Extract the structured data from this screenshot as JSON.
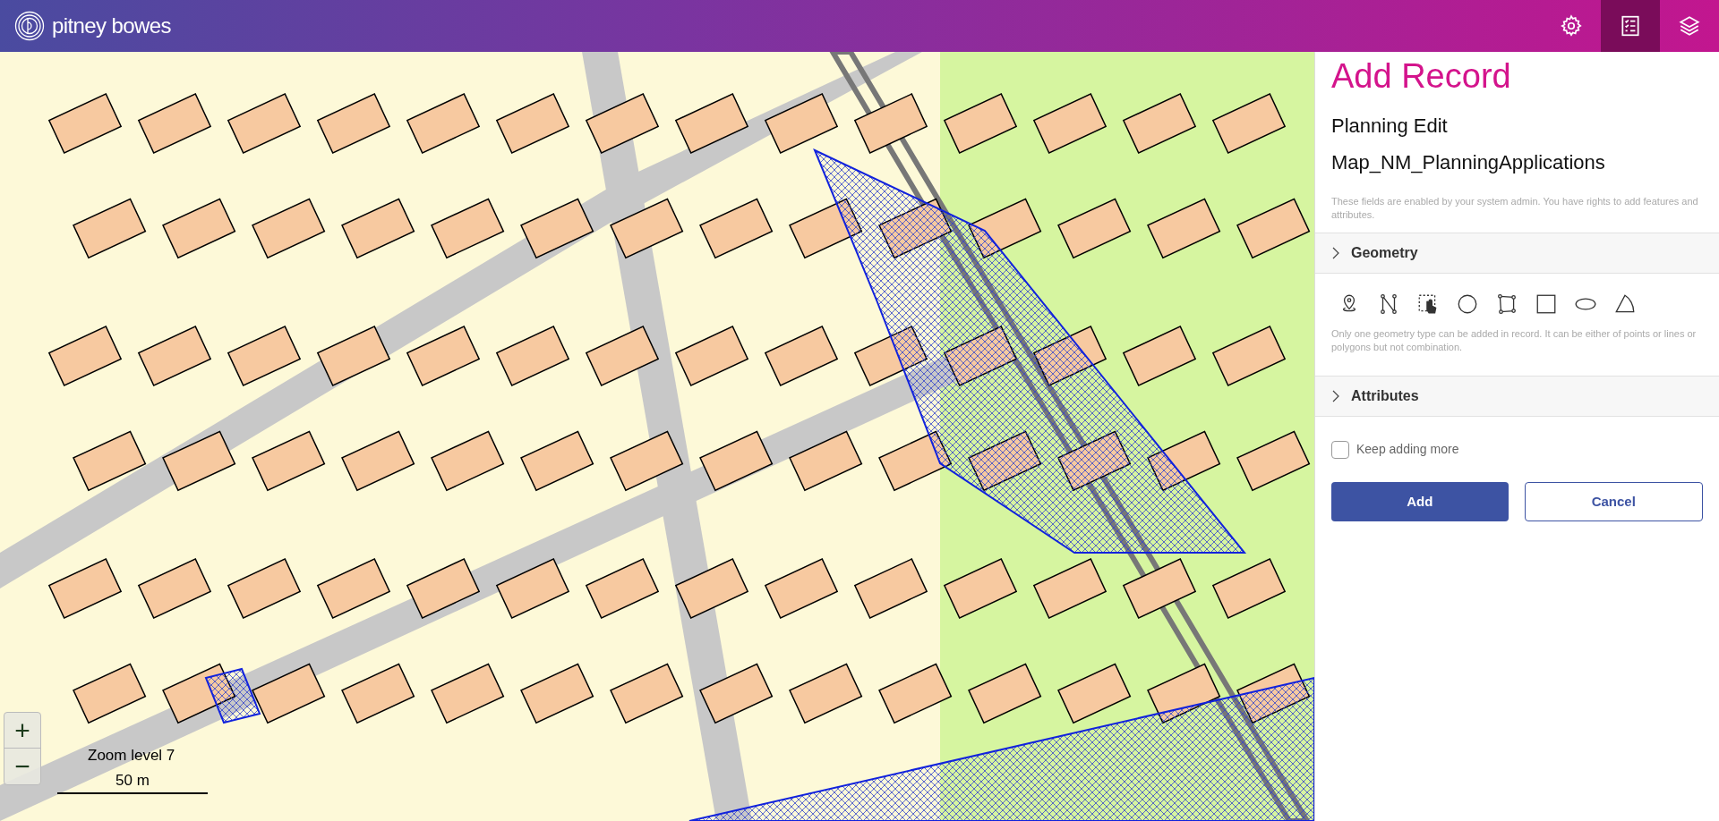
{
  "header": {
    "brand": "pitney bowes",
    "tools": [
      {
        "kind": "settings",
        "selected": false
      },
      {
        "kind": "checklist",
        "selected": true
      },
      {
        "kind": "layers",
        "selected": false
      }
    ]
  },
  "map": {
    "zoom_in": "+",
    "zoom_out": "−",
    "zoom_label": "Zoom level 7",
    "scale_label": "50 m"
  },
  "panel": {
    "title": "Add Record",
    "subtitle": "Planning Edit",
    "layer": "Map_NM_PlanningApplications",
    "note": "These fields are enabled by your system admin. You have rights to add features and attributes.",
    "sections": [
      {
        "kind": "geometry",
        "label": "Geometry",
        "expanded": false
      },
      {
        "kind": "attributes",
        "label": "Attributes",
        "expanded": false
      }
    ],
    "geometry_tools": [
      {
        "kind": "point"
      },
      {
        "kind": "line"
      },
      {
        "kind": "select"
      },
      {
        "kind": "circle"
      },
      {
        "kind": "polygon"
      },
      {
        "kind": "rectangle"
      },
      {
        "kind": "ellipse"
      },
      {
        "kind": "sector"
      }
    ],
    "geometry_note": "Only one geometry type can be added in record. It can be either of points or lines or polygons but not combination.",
    "keep_adding": {
      "label": "Keep adding more",
      "checked": false
    },
    "buttons": [
      {
        "kind": "primary",
        "label": "Add"
      },
      {
        "kind": "secondary",
        "label": "Cancel"
      }
    ]
  }
}
